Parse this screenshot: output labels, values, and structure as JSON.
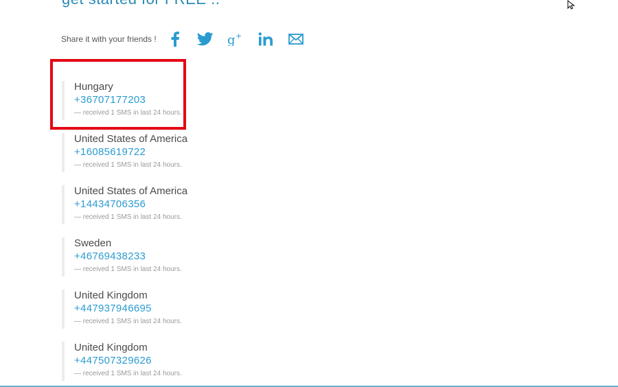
{
  "heading": {
    "text": "get started for FREE .."
  },
  "share": {
    "label": "Share it with your friends !",
    "icons": [
      "facebook-icon",
      "twitter-icon",
      "google-plus-icon",
      "linkedin-icon",
      "email-icon"
    ]
  },
  "numbers": [
    {
      "country": "Hungary",
      "phone": "+36707177203",
      "received": "— received 1 SMS in last 24 hours."
    },
    {
      "country": "United States of America",
      "phone": "+16085619722",
      "received": "— received 1 SMS in last 24 hours."
    },
    {
      "country": "United States of America",
      "phone": "+14434706356",
      "received": "— received 1 SMS in last 24 hours."
    },
    {
      "country": "Sweden",
      "phone": "+46769438233",
      "received": "— received 1 SMS in last 24 hours."
    },
    {
      "country": "United Kingdom",
      "phone": "+447937946695",
      "received": "— received 1 SMS in last 24 hours."
    },
    {
      "country": "United Kingdom",
      "phone": "+447507329626",
      "received": "— received 1 SMS in last 24 hours."
    }
  ],
  "colors": {
    "accent": "#2a9bd0",
    "highlight": "#e30613",
    "heading": "#2a8ab7"
  }
}
